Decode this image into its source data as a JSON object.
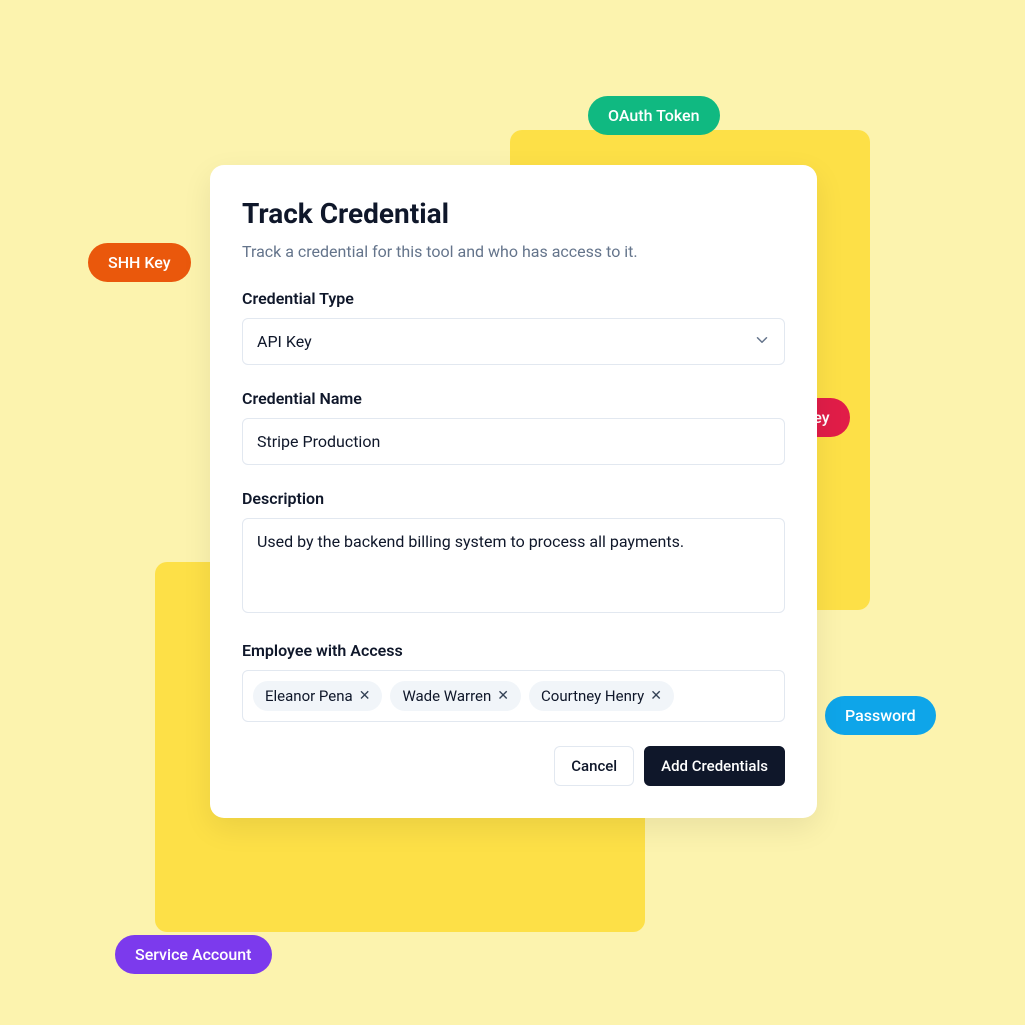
{
  "pills": {
    "oauth": "OAuth Token",
    "shh": "SHH Key",
    "api": "API Key",
    "password": "Password",
    "service": "Service Account"
  },
  "modal": {
    "title": "Track Credential",
    "subtitle": "Track a credential for this tool and who has access to it.",
    "credential_type": {
      "label": "Credential Type",
      "value": "API Key"
    },
    "credential_name": {
      "label": "Credential Name",
      "value": "Stripe Production"
    },
    "description": {
      "label": "Description",
      "value": "Used by the backend billing system to process all payments."
    },
    "employee_access": {
      "label": "Employee with Access",
      "tags": [
        "Eleanor Pena",
        "Wade Warren",
        "Courtney Henry"
      ]
    },
    "buttons": {
      "cancel": "Cancel",
      "add": "Add Credentials"
    }
  }
}
